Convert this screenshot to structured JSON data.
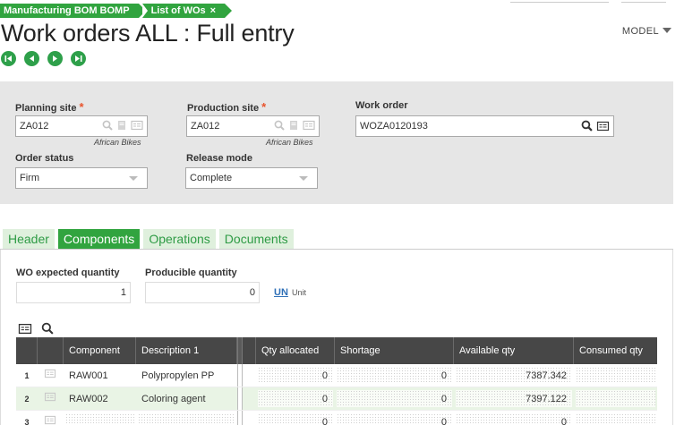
{
  "breadcrumb": {
    "items": [
      {
        "label": "Manufacturing BOM BOMP"
      },
      {
        "label": "List of WOs",
        "close": "×"
      }
    ]
  },
  "page": {
    "title": "Work orders ALL : Full entry",
    "model_label": "MODEL"
  },
  "criteria": {
    "planning_site": {
      "label": "Planning site",
      "required_mark": "*",
      "value": "ZA012",
      "description": "African Bikes"
    },
    "production_site": {
      "label": "Production site",
      "required_mark": "*",
      "value": "ZA012",
      "description": "African Bikes"
    },
    "work_order": {
      "label": "Work order",
      "value": "WOZA0120193"
    },
    "order_status": {
      "label": "Order status",
      "value": "Firm"
    },
    "release_mode": {
      "label": "Release mode",
      "value": "Complete"
    }
  },
  "tabs": [
    {
      "label": "Header",
      "active": false
    },
    {
      "label": "Components",
      "active": true
    },
    {
      "label": "Operations",
      "active": false
    },
    {
      "label": "Documents",
      "active": false
    }
  ],
  "quantities": {
    "expected": {
      "label": "WO expected quantity",
      "value": "1"
    },
    "producible": {
      "label": "Producible quantity",
      "value": "0"
    },
    "unit_code": "UN",
    "unit_label": "Unit"
  },
  "grid": {
    "columns": [
      "Component",
      "Description 1",
      "Qty allocated",
      "Shortage",
      "Available qty",
      "Consumed qty"
    ],
    "rows": [
      {
        "num": "1",
        "component": "RAW001",
        "description": "Polypropylen PP",
        "qty_allocated": "0",
        "shortage": "0",
        "available": "7387.342",
        "consumed": ""
      },
      {
        "num": "2",
        "component": "RAW002",
        "description": "Coloring agent",
        "qty_allocated": "0",
        "shortage": "0",
        "available": "7397.122",
        "consumed": ""
      },
      {
        "num": "3",
        "component": "",
        "description": "",
        "qty_allocated": "0",
        "shortage": "0",
        "available": "0",
        "consumed": ""
      }
    ]
  },
  "colors": {
    "accent_green": "#31a43f",
    "required_orange": "#e8542d",
    "grid_header": "#474747"
  }
}
